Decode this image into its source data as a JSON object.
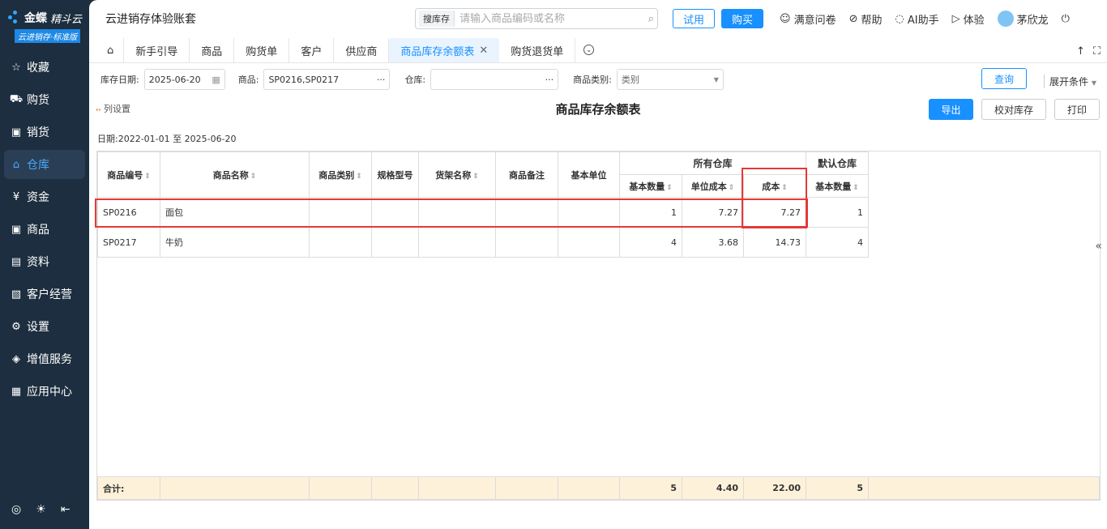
{
  "sidebar": {
    "brand": "金蝶",
    "brand_sub": "精斗云",
    "tag": "云进销存·标准版",
    "items": [
      {
        "label": "收藏",
        "icon": "☆"
      },
      {
        "label": "购货",
        "icon": "🛒"
      },
      {
        "label": "销货",
        "icon": "▣"
      },
      {
        "label": "仓库",
        "icon": "⌂"
      },
      {
        "label": "资金",
        "icon": "¥"
      },
      {
        "label": "商品",
        "icon": "▣"
      },
      {
        "label": "资料",
        "icon": "▤"
      },
      {
        "label": "客户经营",
        "icon": "▧"
      },
      {
        "label": "设置",
        "icon": "⚙"
      },
      {
        "label": "增值服务",
        "icon": "◈"
      },
      {
        "label": "应用中心",
        "icon": "▦"
      }
    ],
    "active_index": 3
  },
  "topbar": {
    "account_title": "云进销存体验账套",
    "search_scope": "搜库存",
    "search_placeholder": "请输入商品编码或名称",
    "trial_label": "试用",
    "buy_label": "购买",
    "links": [
      "满意问卷",
      "帮助",
      "AI助手",
      "体验"
    ],
    "user_name": "茅欣龙"
  },
  "tabs": [
    "新手引导",
    "商品",
    "购货单",
    "客户",
    "供应商",
    "商品库存余额表",
    "购货退货单"
  ],
  "active_tab": "商品库存余额表",
  "filters": {
    "date_label": "库存日期:",
    "date_value": "2025-06-20",
    "product_label": "商品:",
    "product_value": "SP0216,SP0217",
    "warehouse_label": "仓库:",
    "warehouse_value": "",
    "category_label": "商品类别:",
    "category_placeholder": "类别",
    "query_label": "查询",
    "expand_label": "展开条件"
  },
  "report": {
    "column_setting": "列设置",
    "title": "商品库存余额表",
    "export_label": "导出",
    "check_label": "校对库存",
    "print_label": "打印",
    "date_range": "日期:2022-01-01 至 2025-06-20"
  },
  "table": {
    "headers": [
      "商品编号",
      "商品名称",
      "商品类别",
      "规格型号",
      "货架名称",
      "商品备注",
      "基本单位"
    ],
    "group_all": "所有仓库",
    "group_default": "默认仓库",
    "sub_headers": [
      "基本数量",
      "单位成本",
      "成本",
      "基本数量"
    ],
    "rows": [
      {
        "code": "SP0216",
        "name": "面包",
        "category": "",
        "spec": "",
        "shelf": "",
        "note": "",
        "unit": "",
        "qty": "1",
        "unit_cost": "7.27",
        "cost": "7.27",
        "default_qty": "1"
      },
      {
        "code": "SP0217",
        "name": "牛奶",
        "category": "",
        "spec": "",
        "shelf": "",
        "note": "",
        "unit": "",
        "qty": "4",
        "unit_cost": "3.68",
        "cost": "14.73",
        "default_qty": "4"
      }
    ],
    "total": {
      "label": "合计:",
      "qty": "5",
      "unit_cost": "4.40",
      "cost": "22.00",
      "default_qty": "5"
    }
  }
}
